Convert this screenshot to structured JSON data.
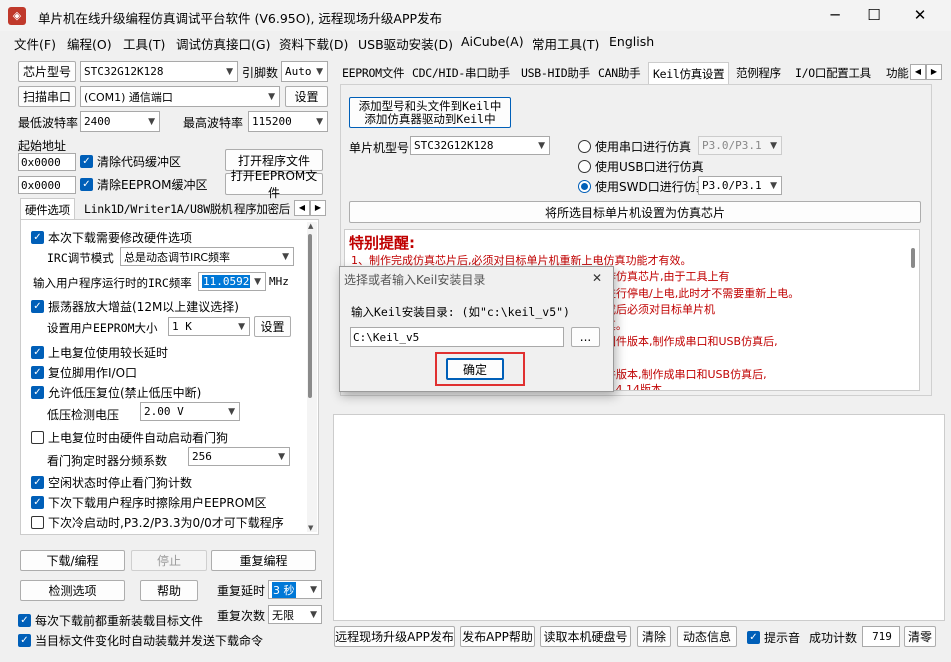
{
  "window": {
    "title": "单片机在线升级编程仿真调试平台软件 (V6.95O), 远程现场升级APP发布",
    "minimize": "─",
    "maximize": "☐",
    "close": "✕",
    "icon": "app-icon"
  },
  "menu": [
    "文件(F)",
    "编程(O)",
    "工具(T)",
    "调试仿真接口(G)",
    "资料下载(D)",
    "USB驱动安装(D)",
    "AiCube(A)",
    "常用工具(T)",
    "English"
  ],
  "left": {
    "chip_btn": "芯片型号",
    "chip_value": "STC32G12K128",
    "pins_label": "引脚数",
    "pins_value": "Auto",
    "scan_btn": "扫描串口",
    "port_value": "(COM1) 通信端口",
    "settings_btn": "设置",
    "min_baud_label": "最低波特率",
    "min_baud": "2400",
    "max_baud_label": "最高波特率",
    "max_baud": "115200",
    "start_addr_label": "起始地址",
    "addr1": "0x0000",
    "clear_code": "清除代码缓冲区",
    "open_prog": "打开程序文件",
    "addr2": "0x0000",
    "clear_eeprom": "清除EEPROM缓冲区",
    "open_eeprom": "打开EEPROM文件",
    "tabs": [
      "硬件选项",
      "Link1D/Writer1A/U8W脱机",
      "程序加密后"
    ],
    "options": {
      "reconfig": "本次下载需要修改硬件选项",
      "irc_mode_label": "IRC调节模式",
      "irc_mode": "总是动态调节IRC频率",
      "irc_freq_label": "输入用户程序运行时的IRC频率",
      "irc_freq": "11.0592",
      "irc_unit": "MHz",
      "osc_gain": "振荡器放大增益(12M以上建议选择)",
      "eeprom_size_label": "设置用户EEPROM大小",
      "eeprom_size": "1   K",
      "eeprom_set": "设置",
      "long_delay": "上电复位使用较长延时",
      "reset_pin": "复位脚用作I/O口",
      "lvr": "允许低压复位(禁止低压中断)",
      "lvd_label": "低压检测电压",
      "lvd": "2.00 V",
      "wdt_auto": "上电复位时由硬件自动启动看门狗",
      "wdt_div_label": "看门狗定时器分频系数",
      "wdt_div": "256",
      "idle_wdt": "空闲状态时停止看门狗计数",
      "erase_eeprom": "下次下载用户程序时擦除用户EEPROM区",
      "cold_boot": "下次冷启动时,P3.2/P3.3为0/0才可下载程序"
    },
    "download_btn": "下载/编程",
    "stop_btn": "停止",
    "reprog_btn": "重复编程",
    "detect_btn": "检测选项",
    "help_btn": "帮助",
    "repeat_delay_label": "重复延时",
    "repeat_delay": "3 秒",
    "repeat_count_label": "重复次数",
    "repeat_count": "无限",
    "reload_each": "每次下载前都重新装载目标文件",
    "auto_reload": "当目标文件变化时自动装载并发送下载命令"
  },
  "right": {
    "tabs": [
      "EEPROM文件",
      "CDC/HID-串口助手",
      "USB-HID助手",
      "CAN助手",
      "Keil仿真设置",
      "范例程序",
      "I/O口配置工具",
      "功能"
    ],
    "add_keil_btn_line1": "添加型号和头文件到Keil中",
    "add_keil_btn_line2": "添加仿真器驱动到Keil中",
    "mcu_label": "单片机型号",
    "mcu_value": "STC32G12K128",
    "sim_serial": "使用串口进行仿真",
    "sim_serial_port": "P3.0/P3.1",
    "sim_usb": "使用USB口进行仿真",
    "sim_swd": "使用SWD口进行仿真",
    "sim_swd_port": "P3.0/P3.1",
    "set_chip_btn": "将所选目标单片机设置为仿真芯片",
    "warning_title": "特别提醒:",
    "warning_lines": [
      "1、制作完成仿真芯片后,必须对目标单片机重新上电仿真功能才有效。",
      "作仿真芯片,由于工具上有",
      "进行停电/上电,此时才不需要重新上电。",
      "成后必须对目标单片机",
      "真。",
      "固件版本,制作成串口和USB仿真后,",
      "件版本,制作成串口和USB仿真后,",
      "7.4.14版本"
    ]
  },
  "bottom": {
    "remote_btn": "远程现场升级APP发布",
    "publish_btn": "发布APP帮助",
    "hdd_btn": "读取本机硬盘号",
    "clear_btn": "清除",
    "dyn_btn": "动态信息",
    "beep": "提示音",
    "success_label": "成功计数",
    "success_count": "719",
    "reset_btn": "清零"
  },
  "dialog": {
    "title": "选择或者输入Keil安装目录",
    "prompt": "输入Keil安装目录: (如\"c:\\keil_v5\")",
    "path": "C:\\Keil_v5",
    "browse": "...",
    "ok": "确定",
    "close": "✕"
  },
  "colors": {
    "accent": "#005fb8",
    "warning": "#c00000",
    "highlight": "#e03030"
  }
}
